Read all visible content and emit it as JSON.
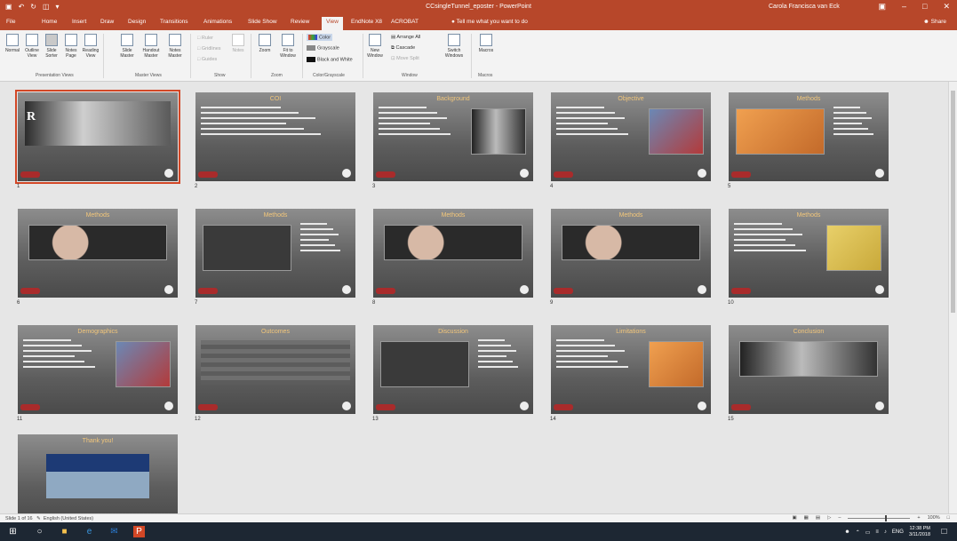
{
  "titlebar": {
    "doc_title": "CCsingleTunnel_eposter - PowerPoint",
    "user": "Carola Francisca van Eck"
  },
  "tabs": [
    "File",
    "Home",
    "Insert",
    "Draw",
    "Design",
    "Transitions",
    "Animations",
    "Slide Show",
    "Review",
    "View",
    "EndNote X8",
    "ACROBAT"
  ],
  "active_tab": "View",
  "tellme": "Tell me what you want to do",
  "share": "Share",
  "ribbon": {
    "presentation_views": [
      "Normal",
      "Outline View",
      "Slide Sorter",
      "Notes Page",
      "Reading View"
    ],
    "master_views": [
      "Slide Master",
      "Handout Master",
      "Notes Master"
    ],
    "show": [
      "Ruler",
      "Gridlines",
      "Guides"
    ],
    "show_notes": "Notes",
    "zoom": [
      "Zoom",
      "Fit to Window"
    ],
    "color": [
      "Color",
      "Grayscale",
      "Black and White"
    ],
    "window_new": "New Window",
    "window_small": [
      "Arrange All",
      "Cascade",
      "Move Split"
    ],
    "window_switch": "Switch Windows",
    "macros": "Macros",
    "groups": [
      "Presentation Views",
      "Master Views",
      "Show",
      "Zoom",
      "Color/Grayscale",
      "Window",
      "Macros"
    ]
  },
  "slides": [
    {
      "num": "1",
      "title": "",
      "type": "cover"
    },
    {
      "num": "2",
      "title": "COI",
      "type": "text"
    },
    {
      "num": "3",
      "title": "Background",
      "type": "text-img"
    },
    {
      "num": "4",
      "title": "Objective",
      "type": "text-img"
    },
    {
      "num": "5",
      "title": "Methods",
      "type": "img-text"
    },
    {
      "num": "6",
      "title": "Methods",
      "type": "wide"
    },
    {
      "num": "7",
      "title": "Methods",
      "type": "img-text"
    },
    {
      "num": "8",
      "title": "Methods",
      "type": "wide"
    },
    {
      "num": "9",
      "title": "Methods",
      "type": "wide"
    },
    {
      "num": "10",
      "title": "Methods",
      "type": "text-img"
    },
    {
      "num": "11",
      "title": "Demographics",
      "type": "text-img"
    },
    {
      "num": "12",
      "title": "Outcomes",
      "type": "table"
    },
    {
      "num": "13",
      "title": "Discussion",
      "type": "img-text"
    },
    {
      "num": "14",
      "title": "Limitations",
      "type": "text-img"
    },
    {
      "num": "15",
      "title": "Conclusion",
      "type": "wide"
    },
    {
      "num": "16",
      "title": "Thank you!",
      "type": "thanks"
    }
  ],
  "cover_letter": "R",
  "status": {
    "slide_count": "Slide 1 of 16",
    "language": "English (United States)",
    "zoom": "100%"
  },
  "taskbar": {
    "lang": "ENG",
    "time": "12:38 PM",
    "date": "3/11/2018"
  }
}
